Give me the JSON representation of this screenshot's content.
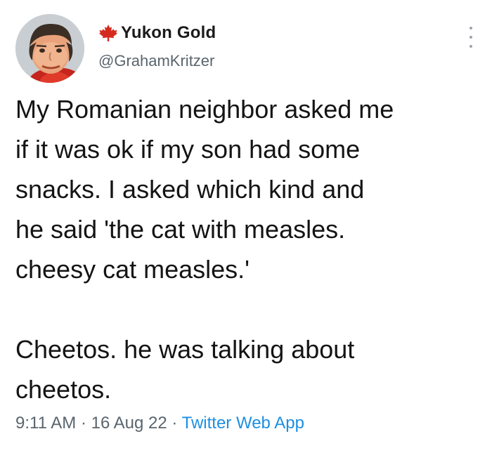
{
  "user": {
    "display_name": "Yukon Gold",
    "handle": "@GrahamKritzer",
    "flag_icon": "maple-leaf-icon",
    "flag_color": "#d52b1e"
  },
  "tweet": {
    "paragraphs": [
      "My Romanian neighbor asked me\nif it was ok if my son had some\nsnacks. I asked which kind and\nhe said 'the cat with measles.\ncheesy cat measles.'",
      "Cheetos. he was talking about\ncheetos."
    ]
  },
  "meta": {
    "time": "9:11 AM",
    "separator": " · ",
    "date": "16 Aug 22",
    "source": "Twitter Web App"
  },
  "colors": {
    "source_link": "#1d8fe2",
    "secondary_text": "#5a656e"
  }
}
